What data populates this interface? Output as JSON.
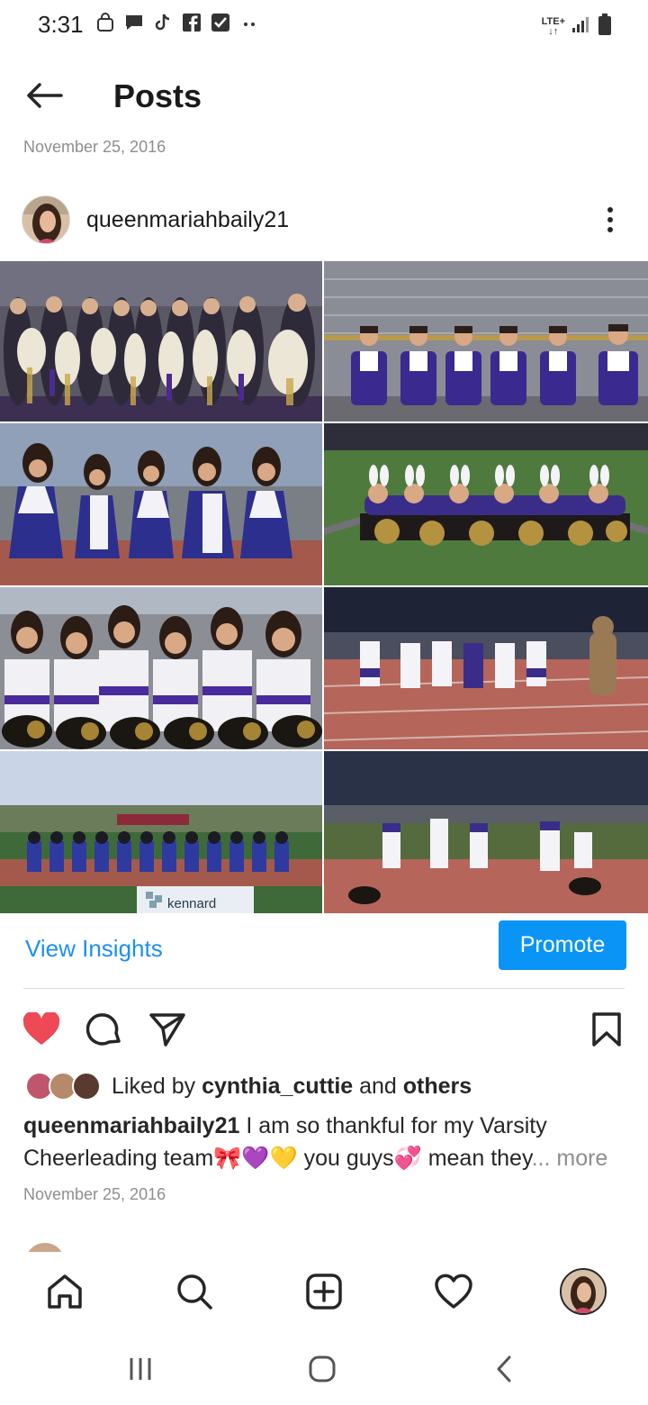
{
  "status_bar": {
    "time": "3:31",
    "network": "LTE+",
    "icons_left": [
      "bag-icon",
      "chat-icon",
      "tiktok-icon",
      "facebook-icon",
      "check-icon",
      "more-dots-icon"
    ],
    "icons_right": [
      "lte-icon",
      "signal-icon",
      "battery-icon"
    ]
  },
  "header": {
    "title": "Posts",
    "date": "November 25, 2016"
  },
  "post": {
    "username": "queenmariahbaily21",
    "photos": [
      "homecoming-mums-group",
      "cheer-team-stands",
      "cheer-team-track",
      "cheer-team-field-lying",
      "cheer-team-pompoms",
      "cheer-team-night-track",
      "cheer-team-lineup-field",
      "cheer-team-night-field"
    ],
    "banner_text": "kennard",
    "view_insights": "View Insights",
    "promote": "Promote",
    "liked_by_prefix": "Liked by ",
    "liked_by_user": "cynthia_cuttie",
    "liked_by_and": " and ",
    "liked_by_others": "others",
    "caption_user": "queenmariahbaily21",
    "caption_text": " I am so thankful for my Varsity Cheerleading team🎀💜💛 you guys💞 mean they",
    "caption_more": "... more",
    "date": "November 25, 2016"
  },
  "bottom_nav": [
    "home-icon",
    "search-icon",
    "add-post-icon",
    "activity-heart-icon",
    "profile-avatar"
  ],
  "system_nav": [
    "recent-apps-icon",
    "home-button-icon",
    "back-nav-icon"
  ],
  "colors": {
    "accent_blue": "#0a95f6",
    "link_blue": "#1d8ff2",
    "like_red": "#ed4956",
    "muted": "#8e8e8e"
  }
}
